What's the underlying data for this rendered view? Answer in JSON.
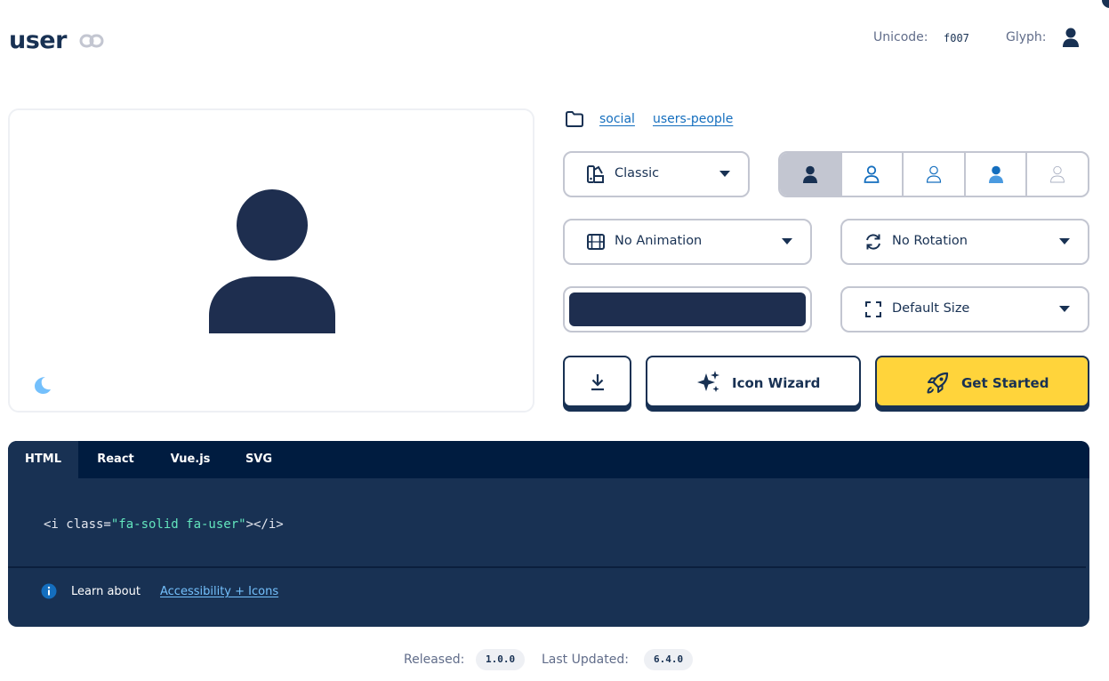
{
  "header": {
    "title": "user",
    "unicode_label": "Unicode:",
    "unicode_value": "f007",
    "glyph_label": "Glyph:",
    "link_icon": "link-icon",
    "glyph_icon": "user-icon"
  },
  "preview": {
    "icon": "user-icon",
    "theme_toggle_icon": "moon-icon"
  },
  "categories": {
    "icon": "folder-icon",
    "items": [
      "social",
      "users-people"
    ]
  },
  "controls": {
    "family_select": {
      "icon": "palette-icon",
      "label": "Classic"
    },
    "style_options": [
      "solid",
      "regular",
      "light",
      "duotone",
      "thin"
    ],
    "animation_select": {
      "icon": "film-icon",
      "label": "No Animation"
    },
    "rotation_select": {
      "icon": "rotate-icon",
      "label": "No Rotation"
    },
    "color": "#1e2e4f",
    "size_select": {
      "icon": "expand-icon",
      "label": "Default Size"
    }
  },
  "actions": {
    "download_icon": "download-icon",
    "wizard_label": "Icon Wizard",
    "wizard_icon": "sparkles-icon",
    "get_started_label": "Get Started",
    "get_started_icon": "rocket-icon"
  },
  "code": {
    "tabs": [
      "HTML",
      "React",
      "Vue.js",
      "SVG"
    ],
    "active_tab": "HTML",
    "snippet_open": "<i class=",
    "snippet_string": "\"fa-solid fa-user\"",
    "snippet_close": "></i>",
    "learn_text": "Learn about",
    "learn_link": "Accessibility + Icons"
  },
  "footer": {
    "released_label": "Released:",
    "released_version": "1.0.0",
    "updated_label": "Last Updated:",
    "updated_version": "6.4.0"
  },
  "colors": {
    "navy": "#183153",
    "accent_yellow": "#ffd43b",
    "link_blue": "#146ebe",
    "code_string": "#63e6be"
  }
}
